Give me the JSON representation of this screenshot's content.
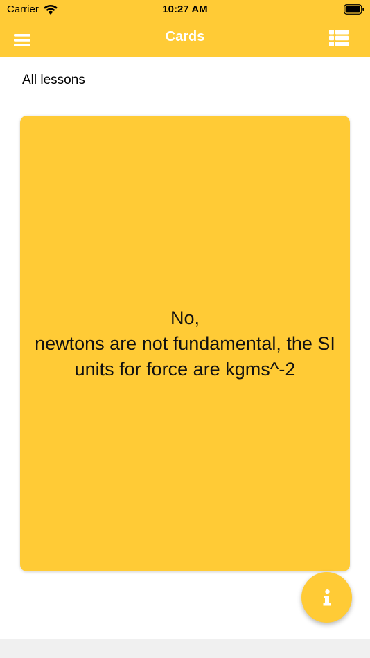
{
  "status_bar": {
    "carrier": "Carrier",
    "time": "10:27 AM"
  },
  "nav": {
    "title": "Cards",
    "menu_icon": "hamburger-menu-icon",
    "list_icon": "list-view-icon"
  },
  "lesson_filter": {
    "label": "All lessons"
  },
  "card": {
    "text": "No,\nnewtons are not fundamental, the SI units for force are kgms^-2"
  },
  "fab": {
    "icon": "info-icon"
  },
  "colors": {
    "accent": "#FFCB36",
    "bar_text": "#FFFFFF"
  }
}
